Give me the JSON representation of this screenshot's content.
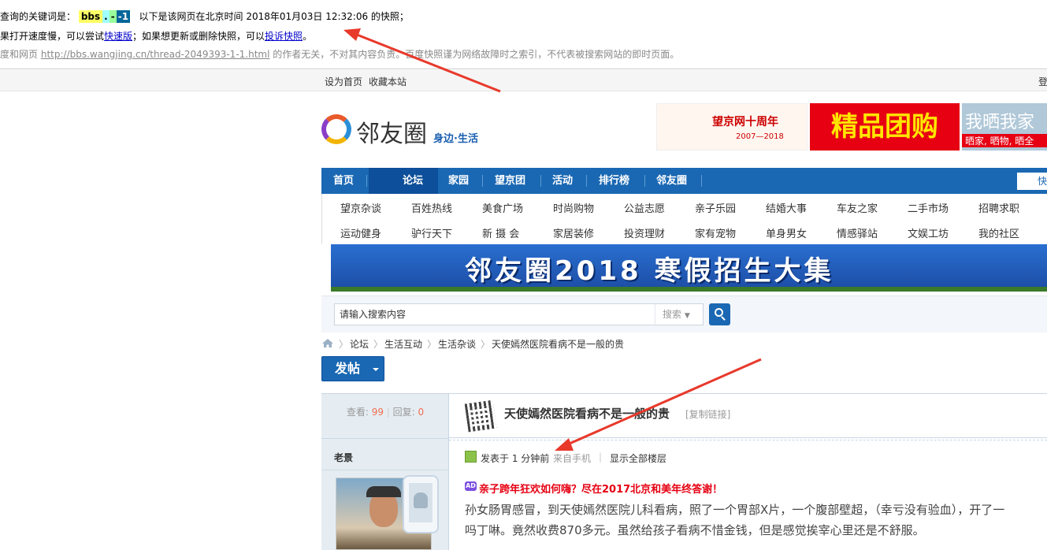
{
  "cache": {
    "line1_prefix": "查询的关键词是：",
    "keywords": [
      "bbs",
      ".",
      "-",
      "-1"
    ],
    "keyword_colors": [
      "#ffff66",
      "#a0ffff",
      "#99ff99",
      "#006699"
    ],
    "line1_suffix": "以下是该网页在北京时间 2018年01月03日 12:32:06 的快照；",
    "line2_a": "果打开速度慢，可以尝试",
    "line2_link1": "快速版",
    "line2_b": "；如果想更新或删除快照，可以",
    "line2_link2": "投诉快照",
    "line2_c": "。",
    "line3_a": "度和网页",
    "line3_url": "http://bbs.wangjing.cn/thread-2049393-1-1.html",
    "line3_b": "的作者无关，不对其内容负责。百度快照谨为网络故障时之索引，不代表被搜索网站的即时页面。"
  },
  "topbar": {
    "set_home": "设为首页",
    "bookmark": "收藏本站",
    "login": "登"
  },
  "logo": {
    "name": "邻友圈",
    "sub": "身边·生活"
  },
  "ads": {
    "ad1_title": "望京网十周年",
    "ad1_years": "2007—2018",
    "ad2": "精品团购",
    "ad3_title": "我晒我家",
    "ad3_sub": "晒家, 晒物, 晒全"
  },
  "nav": {
    "items": [
      "首页",
      "论坛",
      "家园",
      "望京团",
      "活动",
      "排行榜",
      "邻友圈"
    ],
    "search_label": "快"
  },
  "subnav": {
    "row1": [
      "望京杂谈",
      "百姓热线",
      "美食广场",
      "时尚购物",
      "公益志愿",
      "亲子乐园",
      "结婚大事",
      "车友之家",
      "二手市场",
      "招聘求职"
    ],
    "row2": [
      "运动健身",
      "驴行天下",
      "新 摄 会",
      "家居装修",
      "投资理财",
      "家有宠物",
      "单身男女",
      "情感驿站",
      "文娱工坊",
      "我的社区"
    ]
  },
  "banner": {
    "text": "邻友圈2018  寒假招生大集"
  },
  "search": {
    "placeholder": "请输入搜索内容",
    "select": "搜索"
  },
  "breadcrumb": [
    "论坛",
    "生活互动",
    "生活杂谈",
    "天使嫣然医院看病不是一般的贵"
  ],
  "post_button": "发帖",
  "thread": {
    "views_label": "查看:",
    "views": "99",
    "replies_label": "回复:",
    "replies": "0",
    "author": "老景",
    "title": "天使嫣然医院看病不是一般的贵",
    "copy_link": "[复制链接]",
    "posted": "发表于 1 分钟前",
    "from_mobile": "来自手机",
    "show_all": "显示全部楼层",
    "promo": "亲子跨年狂欢如何嗨？尽在2017北京和美年终答谢！",
    "body_line1": "孙女肠胃感冒，到天使嫣然医院儿科看病，照了一个胃部X片，一个腹部壁超，（幸亏没有验血），开了一",
    "body_line2": "吗丁啉。竟然收费870多元。虽然给孩子看病不惜金钱，但是感觉挨宰心里还是不舒服。"
  },
  "colors": {
    "nav_blue": "#1a68b3",
    "arrow_red": "#e8392b",
    "promo_red": "#e60012"
  }
}
